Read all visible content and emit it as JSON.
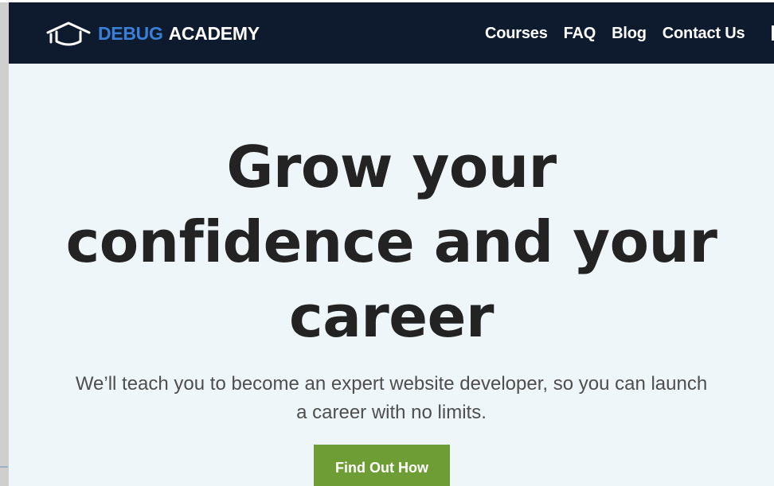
{
  "brand": {
    "word1": "DEBUG",
    "word2": "ACADEMY",
    "logo_icon": "graduation-cap-icon",
    "accent_color": "#3a7fd6"
  },
  "nav": {
    "items": [
      "Courses",
      "FAQ",
      "Blog",
      "Contact Us"
    ],
    "background_color": "#0e1b2e"
  },
  "hero": {
    "title_lines": [
      "Grow your",
      "confidence and your",
      "career"
    ],
    "subtitle_lines": [
      "We’ll teach you to become an expert website developer, so you can launch",
      "a career with no limits."
    ],
    "cta_label": "Find Out How",
    "cta_color": "#6e9d36",
    "background_color": "#eef6fa"
  }
}
